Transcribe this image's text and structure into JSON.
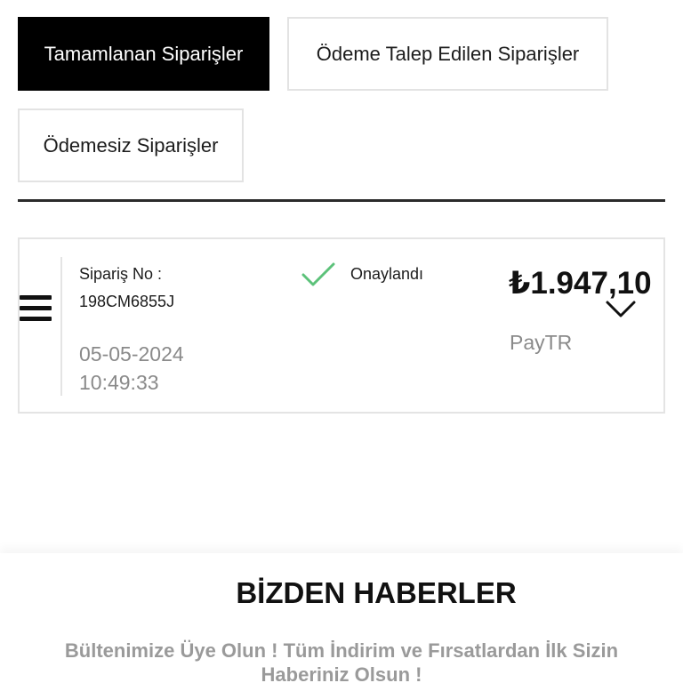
{
  "tabs": [
    {
      "label": "Tamamlanan Siparişler",
      "active": true
    },
    {
      "label": "Ödeme Talep Edilen Siparişler",
      "active": false
    },
    {
      "label": "Ödemesiz Siparişler",
      "active": false
    }
  ],
  "order": {
    "label": "Sipariş No :",
    "number": "198CM6855J",
    "date": "05-05-2024",
    "time": "10:49:33",
    "status": "Onaylandı",
    "status_icon": "check-icon",
    "price": "₺1.947,10",
    "payment_method": "PayTR"
  },
  "newsletter": {
    "title": "BİZDEN HABERLER",
    "subtitle": "Bültenimize Üye Olun ! Tüm İndirim ve Fırsatlardan İlk Sizin Haberiniz Olsun !"
  },
  "colors": {
    "active_tab_bg": "#000000",
    "status_check": "#5cc27a",
    "muted_text": "#8a8a8a"
  }
}
